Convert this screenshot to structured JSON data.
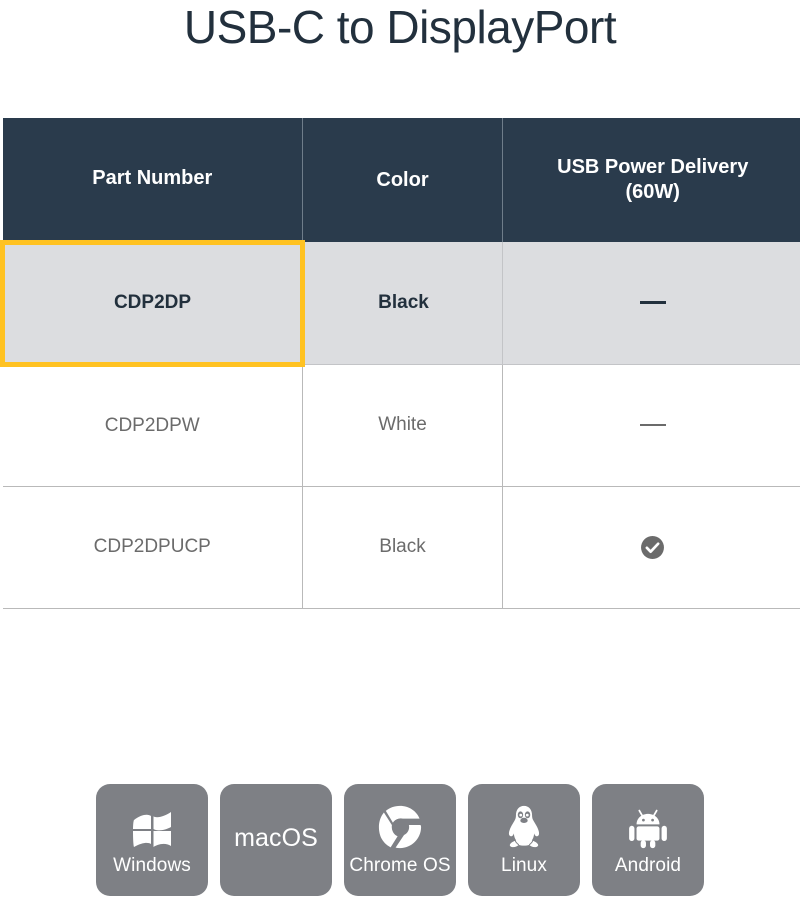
{
  "title": "USB-C to DisplayPort",
  "table": {
    "headers": [
      "Part Number",
      "Color",
      "USB Power Delivery (60W)"
    ],
    "header_lines": {
      "power_line1": "USB Power Delivery",
      "power_line2": "(60W)"
    },
    "rows": [
      {
        "part_number": "CDP2DP",
        "color": "Black",
        "power_delivery": "—",
        "power_delivery_type": "dash",
        "highlighted": true,
        "selected_cell": "part_number"
      },
      {
        "part_number": "CDP2DPW",
        "color": "White",
        "power_delivery": "—",
        "power_delivery_type": "dash",
        "highlighted": false
      },
      {
        "part_number": "CDP2DPUCP",
        "color": "Black",
        "power_delivery": "✓",
        "power_delivery_type": "check",
        "highlighted": false
      }
    ]
  },
  "os_support": {
    "badges": [
      {
        "label": "Windows",
        "icon": "windows-flag-icon",
        "trademark": "·"
      },
      {
        "label": "macOS",
        "icon": "none"
      },
      {
        "label": "Chrome OS",
        "icon": "chrome-wheel-icon"
      },
      {
        "label": "Linux",
        "icon": "tux-penguin-icon"
      },
      {
        "label": "Android",
        "icon": "android-robot-icon"
      }
    ]
  },
  "colors": {
    "header_bg": "#2a3b4c",
    "highlight_row_bg": "#dcdde0",
    "selection_border": "#ffc222",
    "badge_bg": "#7e8085",
    "title_text": "#22303d",
    "body_text": "#6b6b6b"
  }
}
